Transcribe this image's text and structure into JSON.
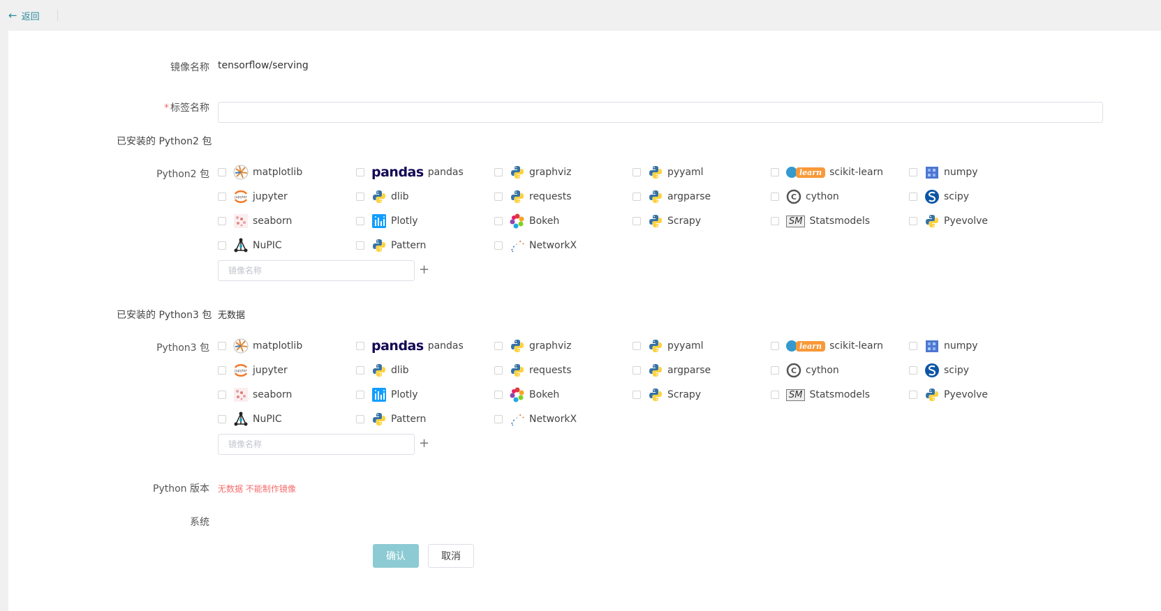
{
  "topbar": {
    "back_label": "返回"
  },
  "form": {
    "image_name_label": "镜像名称",
    "image_name_value": "tensorflow/serving",
    "tag_name_required": "*",
    "tag_name_label": "标签名称",
    "tag_name_value": "",
    "py2_installed_label": "已安装的 Python2 包",
    "py2_packages_label": "Python2 包",
    "py3_installed_label": "已安装的 Python3 包",
    "py3_installed_value": "无数据",
    "py3_packages_label": "Python3 包",
    "add_placeholder": "镜像名称",
    "python_version_label": "Python 版本",
    "python_version_warning": "无数据 不能制作镜像",
    "system_label": "系统",
    "confirm_label": "确认",
    "cancel_label": "取消"
  },
  "packages": [
    {
      "name": "matplotlib",
      "icon": "matplotlib-icon"
    },
    {
      "name": "pandas",
      "icon": "pandas-logo",
      "logo_text": "pandas"
    },
    {
      "name": "graphviz",
      "icon": "python-icon"
    },
    {
      "name": "pyyaml",
      "icon": "python-icon"
    },
    {
      "name": "scikit-learn",
      "icon": "scikit-learn-logo",
      "logo_text": "learn"
    },
    {
      "name": "numpy",
      "icon": "numpy-icon"
    },
    {
      "name": "jupyter",
      "icon": "jupyter-icon"
    },
    {
      "name": "dlib",
      "icon": "python-icon"
    },
    {
      "name": "requests",
      "icon": "python-icon"
    },
    {
      "name": "argparse",
      "icon": "python-icon"
    },
    {
      "name": "cython",
      "icon": "cython-icon"
    },
    {
      "name": "scipy",
      "icon": "scipy-icon"
    },
    {
      "name": "seaborn",
      "icon": "seaborn-icon"
    },
    {
      "name": "Plotly",
      "icon": "plotly-icon"
    },
    {
      "name": "Bokeh",
      "icon": "bokeh-icon"
    },
    {
      "name": "Scrapy",
      "icon": "python-icon"
    },
    {
      "name": "Statsmodels",
      "icon": "statsmodels-logo",
      "logo_text": "SM"
    },
    {
      "name": "Pyevolve",
      "icon": "python-icon"
    },
    {
      "name": "NuPIC",
      "icon": "nupic-icon"
    },
    {
      "name": "Pattern",
      "icon": "python-icon"
    },
    {
      "name": "NetworkX",
      "icon": "networkx-icon"
    }
  ],
  "colors": {
    "accent": "#2a8a9a",
    "confirm_bg": "#8ccbd3",
    "warning": "#f56c6c"
  }
}
